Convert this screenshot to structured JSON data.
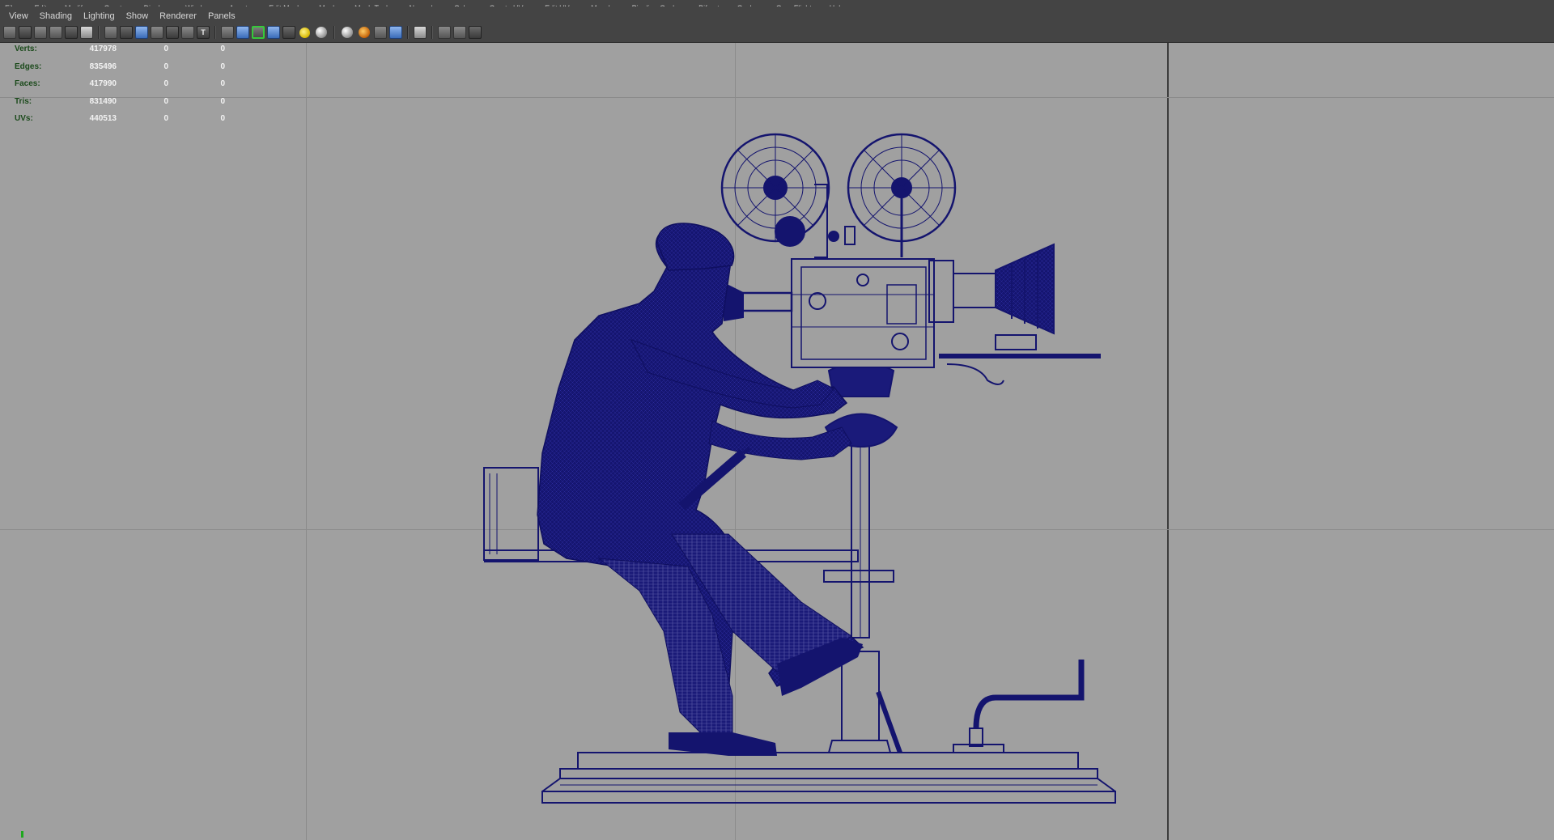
{
  "app_menu": [
    "File",
    "Edit",
    "Modify",
    "Create",
    "Display",
    "Window",
    "Assets",
    "Edit Mesh",
    "Mesh",
    "Mesh Tools",
    "Normals",
    "Color",
    "Create UVs",
    "Edit UVs",
    "Muscle",
    "Pipeline Cache",
    "Bifrost",
    "Cache",
    "OpenFlight",
    "Help"
  ],
  "panel_menu": {
    "view": "View",
    "shading": "Shading",
    "lighting": "Lighting",
    "show": "Show",
    "renderer": "Renderer",
    "panels": "Panels"
  },
  "heads_up": {
    "rows": [
      {
        "label": "Verts:",
        "total": "417978",
        "selected": "0",
        "components": "0"
      },
      {
        "label": "Edges:",
        "total": "835496",
        "selected": "0",
        "components": "0"
      },
      {
        "label": "Faces:",
        "total": "417990",
        "selected": "0",
        "components": "0"
      },
      {
        "label": "Tris:",
        "total": "831490",
        "selected": "0",
        "components": "0"
      },
      {
        "label": "UVs:",
        "total": "440513",
        "selected": "0",
        "components": "0"
      }
    ]
  },
  "toolbar_icons": [
    "camera-select-icon",
    "camera-attributes-icon",
    "bookmark-icon",
    "image-plane-icon",
    "2d-pan-zoom-icon",
    "grease-pencil-icon",
    "grid-icon",
    "film-gate-icon",
    "resolution-gate-icon",
    "gate-mask-icon",
    "field-chart-icon",
    "safe-action-icon",
    "safe-title-icon",
    "wireframe-icon",
    "smooth-shade-icon",
    "wireframe-on-shaded-icon",
    "xray-icon",
    "default-lighting-icon",
    "shadows-icon",
    "screen-space-ao-icon",
    "motion-blur-icon",
    "anti-aliasing-icon",
    "depth-of-field-icon",
    "isolate-select-icon",
    "xray-joints-icon",
    "xray-active-icon"
  ],
  "colors": {
    "viewport_bg": "#a0a0a0",
    "wireframe": "#14146e",
    "panel_bg": "#444444",
    "hud_label": "#1b4a1b",
    "hud_value": "#f2f2f2"
  }
}
